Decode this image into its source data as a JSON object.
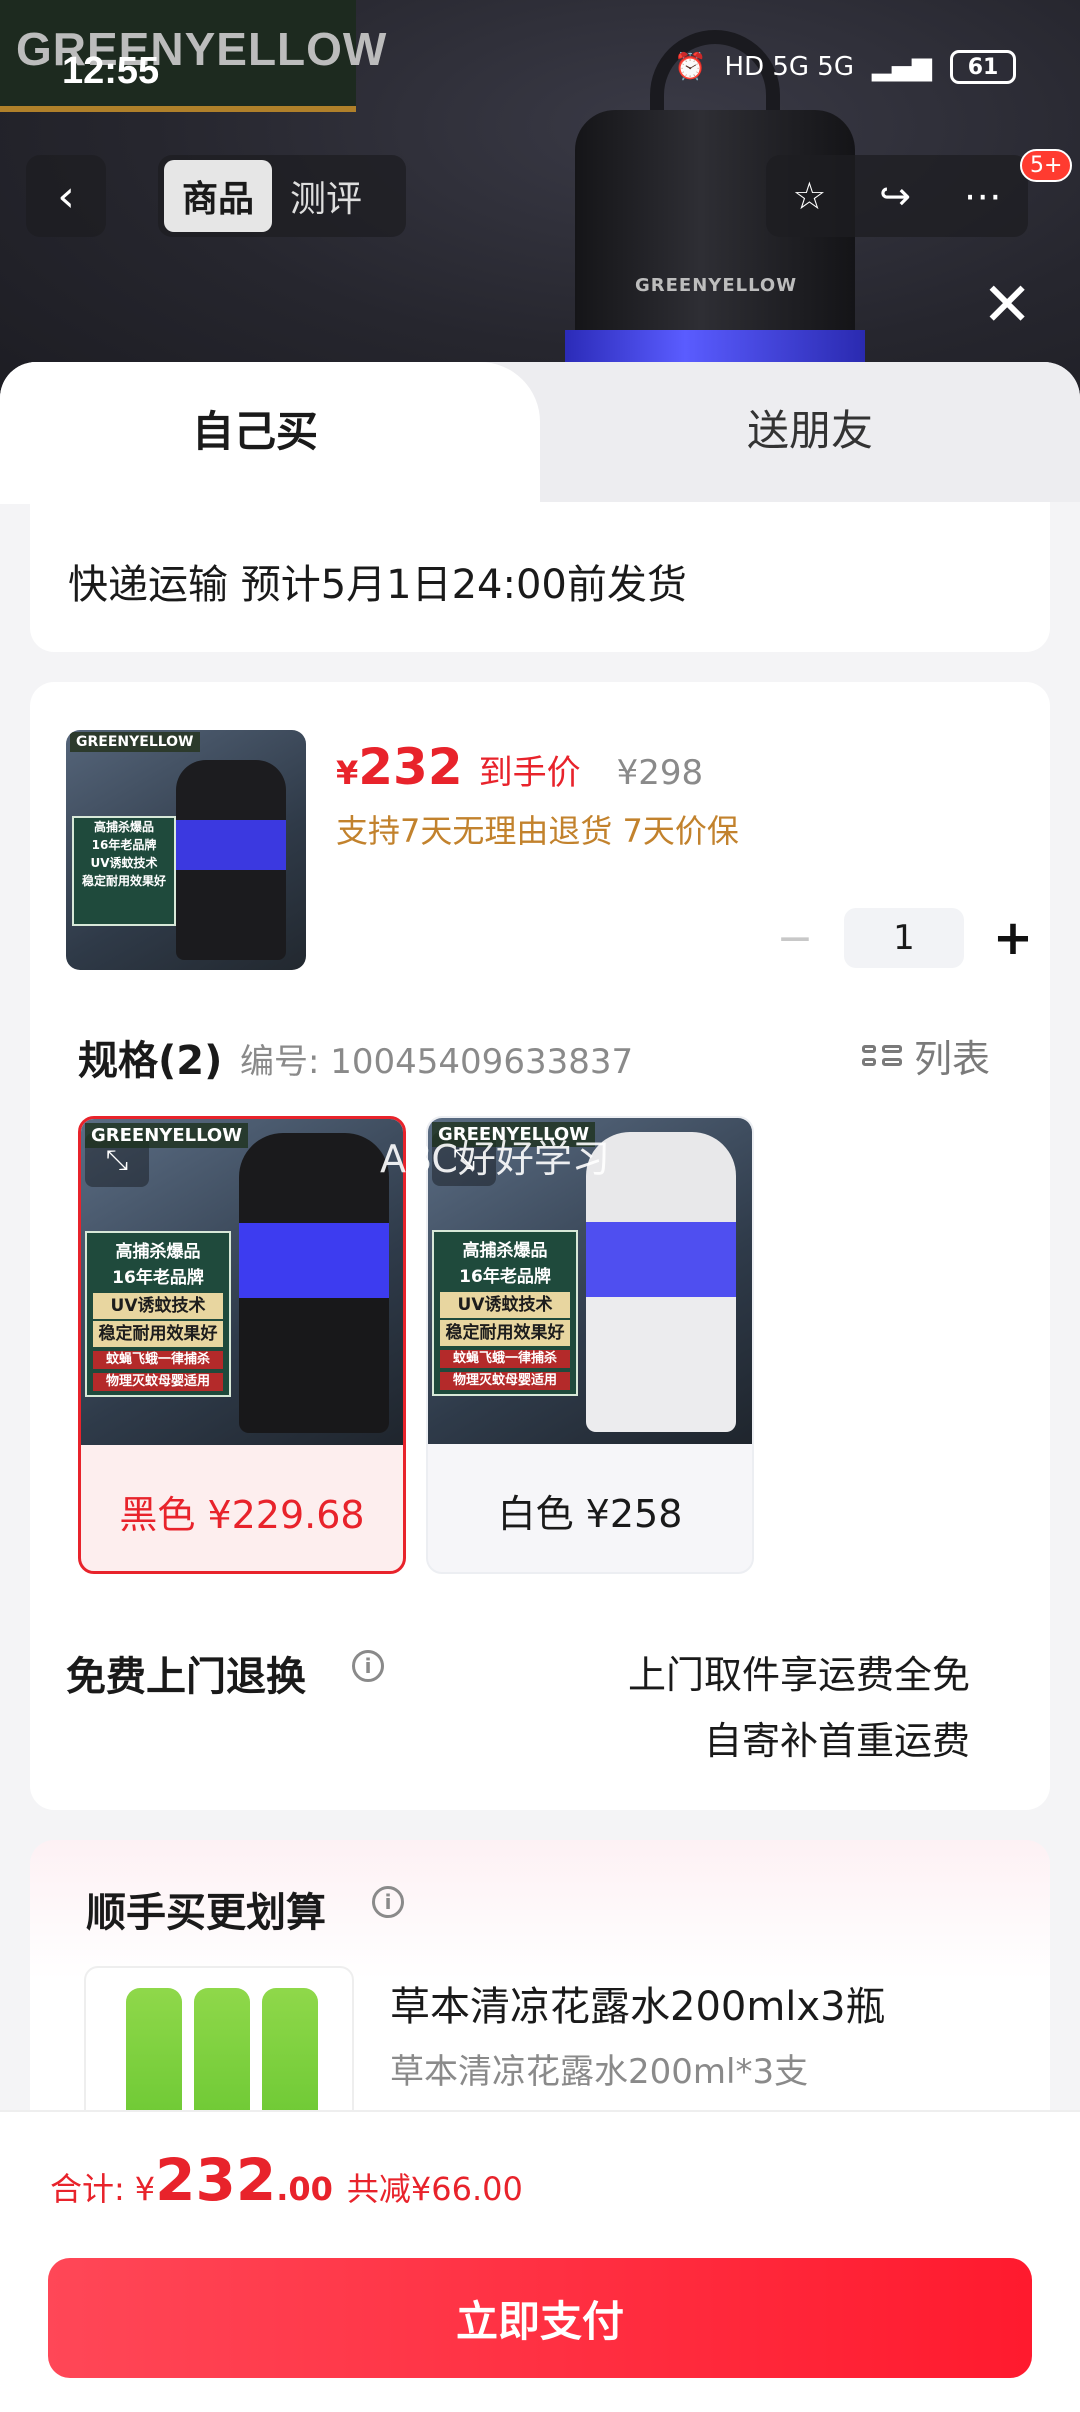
{
  "status_bar": {
    "time": "12:55",
    "network": "HD 5G 5G",
    "battery": "61"
  },
  "hero": {
    "logo_text": "GREENYELLOW",
    "product_brand": "GREENYELLOW"
  },
  "nav": {
    "tab_active": "商品",
    "tab_inactive": "测评",
    "badge": "5+"
  },
  "sheet_tabs": {
    "self_buy": "自己买",
    "gift": "送朋友"
  },
  "shipping": {
    "text": "快递运输 预计5月1日24:00前发货"
  },
  "product": {
    "currency": "¥",
    "price_now": "232",
    "price_label": "到手价",
    "price_orig": "¥298",
    "guarantee": "支持7天无理由退货 7天价保",
    "quantity": "1",
    "thumb_logo": "GREENYELLOW",
    "thumb_lines": [
      "高捕杀爆品",
      "16年老品牌",
      "UV诱蚊技术",
      "稳定耐用效果好"
    ]
  },
  "spec": {
    "title": "规格(2)",
    "code": "编号: 10045409633837",
    "list_label": "列表",
    "variants": [
      {
        "label": "黑色 ¥229.68",
        "selected": true,
        "color": "black"
      },
      {
        "label": "白色 ¥258",
        "selected": false,
        "color": "white"
      }
    ],
    "variant_logo": "GREENYELLOW",
    "variant_lines": [
      "高捕杀爆品",
      "16年老品牌",
      "UV诱蚊技术",
      "稳定耐用效果好",
      "蚊蝇飞蛾一律捕杀",
      "物理灭蚊母婴适用"
    ],
    "watermark": "ABC好好学习"
  },
  "returns": {
    "title": "免费上门退换",
    "line1": "上门取件享运费全免",
    "line2": "自寄补首重运费"
  },
  "bundle": {
    "title": "顺手买更划算",
    "name": "草本清凉花露水200mlx3瓶",
    "desc": "草本清凉花露水200ml*3支"
  },
  "footer": {
    "total_label": "合计:",
    "currency": "¥",
    "total_int": "232",
    "total_dec": ".00",
    "discount": "共减¥66.00",
    "pay_label": "立即支付"
  },
  "colors": {
    "accent": "#e8232b",
    "guarantee": "#c2822d"
  }
}
